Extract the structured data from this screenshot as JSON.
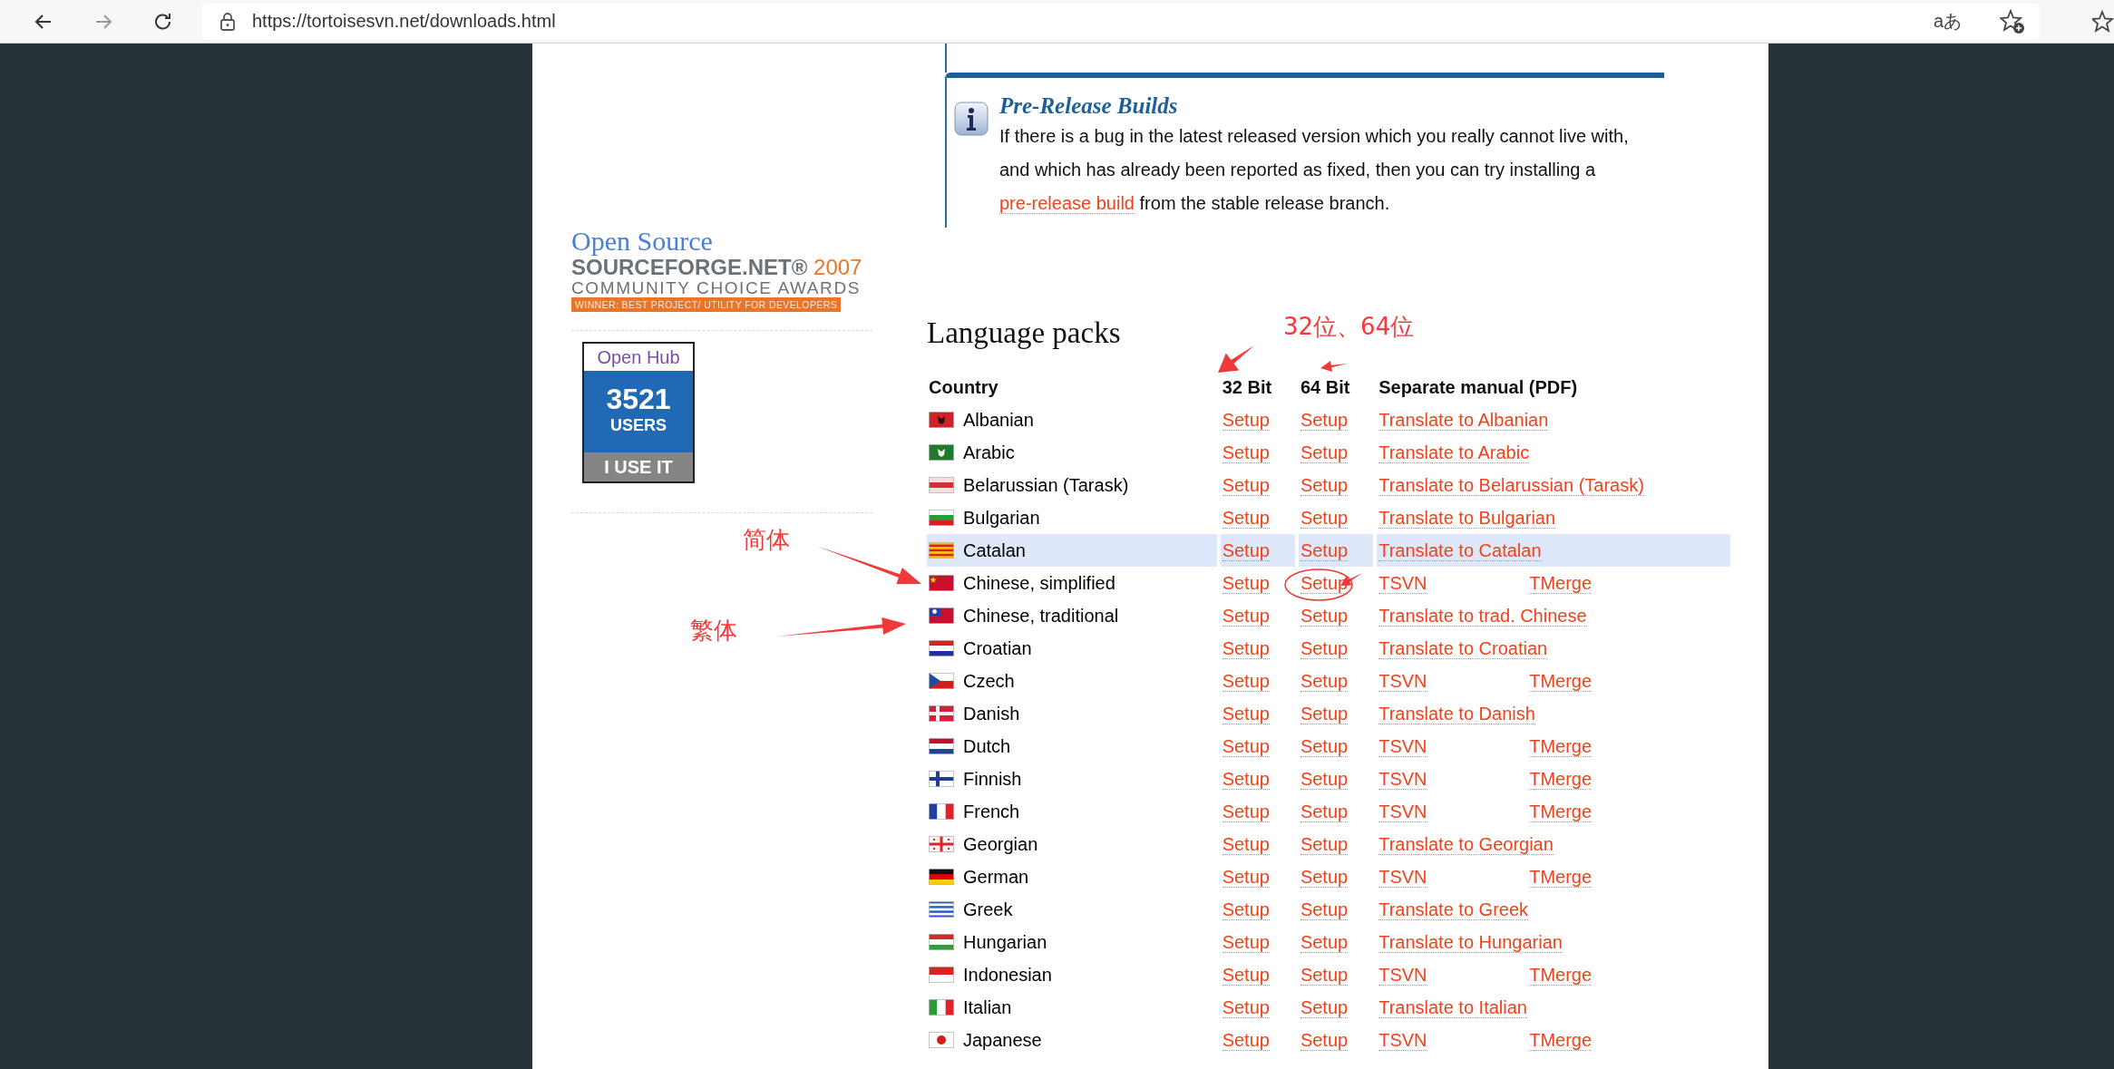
{
  "browser": {
    "nav": [
      {
        "kind": "back",
        "disabled": false
      },
      {
        "kind": "forward",
        "disabled": true
      },
      {
        "kind": "reload",
        "disabled": false
      }
    ],
    "url": "https://tortoisesvn.net/downloads.html",
    "reader_icon": "aあ"
  },
  "sidebar": {
    "award": {
      "title": "Open Source",
      "brand": "SOURCE**FORGE**.NET®",
      "year": "2007",
      "subtitle": "COMMUNITY CHOICE AWARDS",
      "banner": "WINNER: BEST PROJECT/ UTILITY FOR DEVELOPERS"
    },
    "badge": {
      "title": "Open Hub",
      "count": "3521",
      "unit": "USERS",
      "button": "I USE IT"
    }
  },
  "info_box": {
    "title": "Pre-Release Builds",
    "text": "If there is a bug in the latest released version which you really cannot live with, and which has already been reported as fixed, then you can try installing a ",
    "link": "pre-release build",
    "text_after": " from the stable release branch."
  },
  "language_packs": {
    "heading": "Language packs",
    "columns": [
      "Country",
      "32 Bit",
      "64 Bit",
      "Separate manual (PDF)"
    ],
    "rows": [
      {
        "country": "Albanian",
        "flag": {
          "kind": "emblem",
          "parts": [
            {
              "color": "#d0202a"
            },
            {
              "color": "#2a1010"
            }
          ]
        },
        "setup32": "Setup",
        "setup64": "Setup",
        "manual": [
          "Translate to Albanian"
        ],
        "highlighted": false
      },
      {
        "country": "Arabic",
        "flag": {
          "kind": "emblem",
          "parts": [
            {
              "color": "#1f7a2c"
            },
            {
              "color": "#e8f4e8"
            }
          ]
        },
        "setup32": "Setup",
        "setup64": "Setup",
        "manual": [
          "Translate to Arabic"
        ],
        "highlighted": false
      },
      {
        "country": "Belarussian (Tarask)",
        "flag": {
          "kind": "stripes",
          "parts": [
            {
              "color": "#f4dede"
            },
            {
              "color": "#d0303a"
            },
            {
              "color": "#f4dede"
            }
          ]
        },
        "setup32": "Setup",
        "setup64": "Setup",
        "manual": [
          "Translate to Belarussian (Tarask)"
        ],
        "highlighted": false
      },
      {
        "country": "Bulgarian",
        "flag": {
          "kind": "stripes",
          "parts": [
            {
              "color": "#ffffff"
            },
            {
              "color": "#2a9a3a"
            },
            {
              "color": "#d81e1e"
            }
          ]
        },
        "setup32": "Setup",
        "setup64": "Setup",
        "manual": [
          "Translate to Bulgarian"
        ],
        "highlighted": false
      },
      {
        "country": "Catalan",
        "flag": {
          "kind": "stripes",
          "parts": [
            {
              "color": "#f5c400"
            },
            {
              "color": "#d82020"
            },
            {
              "color": "#f5c400"
            },
            {
              "color": "#d82020"
            },
            {
              "color": "#f5c400"
            },
            {
              "color": "#d82020"
            },
            {
              "color": "#f5c400"
            }
          ]
        },
        "setup32": "Setup",
        "setup64": "Setup",
        "manual": [
          "Translate to Catalan"
        ],
        "highlighted": true
      },
      {
        "country": "Chinese, simplified",
        "flag": {
          "kind": "star",
          "parts": [
            {
              "color": "#c8102e"
            },
            {
              "color": "#ffde00"
            }
          ]
        },
        "setup32": "Setup",
        "setup64": "Setup",
        "manual": [
          "TSVN",
          "TMerge"
        ],
        "highlighted": false
      },
      {
        "country": "Chinese, traditional",
        "flag": {
          "kind": "canton",
          "parts": [
            {
              "color": "#c8102e"
            },
            {
              "color": "#1e3fb0"
            }
          ]
        },
        "setup32": "Setup",
        "setup64": "Setup",
        "manual": [
          "Translate to trad. Chinese"
        ],
        "highlighted": false
      },
      {
        "country": "Croatian",
        "flag": {
          "kind": "stripes",
          "parts": [
            {
              "color": "#e02020"
            },
            {
              "color": "#ffffff"
            },
            {
              "color": "#2030a0"
            }
          ]
        },
        "setup32": "Setup",
        "setup64": "Setup",
        "manual": [
          "Translate to Croatian"
        ],
        "highlighted": false
      },
      {
        "country": "Czech",
        "flag": {
          "kind": "triangle",
          "parts": [
            {
              "color": "#ffffff"
            },
            {
              "color": "#d41e1e"
            },
            {
              "color": "#1b4fa0"
            }
          ]
        },
        "setup32": "Setup",
        "setup64": "Setup",
        "manual": [
          "TSVN",
          "TMerge"
        ],
        "highlighted": false
      },
      {
        "country": "Danish",
        "flag": {
          "kind": "cross",
          "parts": [
            {
              "color": "#d81e3c"
            },
            {
              "color": "#f4f4f4"
            }
          ]
        },
        "setup32": "Setup",
        "setup64": "Setup",
        "manual": [
          "Translate to Danish"
        ],
        "highlighted": false
      },
      {
        "country": "Dutch",
        "flag": {
          "kind": "stripes",
          "parts": [
            {
              "color": "#c8102e"
            },
            {
              "color": "#ffffff"
            },
            {
              "color": "#21468b"
            }
          ]
        },
        "setup32": "Setup",
        "setup64": "Setup",
        "manual": [
          "TSVN",
          "TMerge"
        ],
        "highlighted": false
      },
      {
        "country": "Finnish",
        "flag": {
          "kind": "cross",
          "parts": [
            {
              "color": "#ffffff"
            },
            {
              "color": "#1c3f94"
            }
          ]
        },
        "setup32": "Setup",
        "setup64": "Setup",
        "manual": [
          "TSVN",
          "TMerge"
        ],
        "highlighted": false
      },
      {
        "country": "French",
        "flag": {
          "kind": "bars",
          "parts": [
            {
              "color": "#1f3fa0"
            },
            {
              "color": "#ffffff"
            },
            {
              "color": "#e0202a"
            }
          ]
        },
        "setup32": "Setup",
        "setup64": "Setup",
        "manual": [
          "TSVN",
          "TMerge"
        ],
        "highlighted": false
      },
      {
        "country": "Georgian",
        "flag": {
          "kind": "centercross",
          "parts": [
            {
              "color": "#f4f4f4"
            },
            {
              "color": "#e0202a"
            }
          ]
        },
        "setup32": "Setup",
        "setup64": "Setup",
        "manual": [
          "Translate to Georgian"
        ],
        "highlighted": false
      },
      {
        "country": "German",
        "flag": {
          "kind": "stripes",
          "parts": [
            {
              "color": "#111111"
            },
            {
              "color": "#dd0000"
            },
            {
              "color": "#ffce00"
            }
          ]
        },
        "setup32": "Setup",
        "setup64": "Setup",
        "manual": [
          "TSVN",
          "TMerge"
        ],
        "highlighted": false
      },
      {
        "country": "Greek",
        "flag": {
          "kind": "stripes",
          "parts": [
            {
              "color": "#2c5fcf"
            },
            {
              "color": "#ffffff"
            },
            {
              "color": "#2c5fcf"
            },
            {
              "color": "#ffffff"
            },
            {
              "color": "#2c5fcf"
            },
            {
              "color": "#ffffff"
            },
            {
              "color": "#2c5fcf"
            }
          ]
        },
        "setup32": "Setup",
        "setup64": "Setup",
        "manual": [
          "Translate to Greek"
        ],
        "highlighted": false
      },
      {
        "country": "Hungarian",
        "flag": {
          "kind": "stripes",
          "parts": [
            {
              "color": "#d62a2a"
            },
            {
              "color": "#ffffff"
            },
            {
              "color": "#3a9a3a"
            }
          ]
        },
        "setup32": "Setup",
        "setup64": "Setup",
        "manual": [
          "Translate to Hungarian"
        ],
        "highlighted": false
      },
      {
        "country": "Indonesian",
        "flag": {
          "kind": "stripes",
          "parts": [
            {
              "color": "#e02020"
            },
            {
              "color": "#ffffff"
            }
          ]
        },
        "setup32": "Setup",
        "setup64": "Setup",
        "manual": [
          "TSVN",
          "TMerge"
        ],
        "highlighted": false
      },
      {
        "country": "Italian",
        "flag": {
          "kind": "bars",
          "parts": [
            {
              "color": "#2a9a3a"
            },
            {
              "color": "#ffffff"
            },
            {
              "color": "#e0202a"
            }
          ]
        },
        "setup32": "Setup",
        "setup64": "Setup",
        "manual": [
          "Translate to Italian"
        ],
        "highlighted": false
      },
      {
        "country": "Japanese",
        "flag": {
          "kind": "disc",
          "parts": [
            {
              "color": "#ffffff"
            },
            {
              "color": "#d41e1e"
            }
          ]
        },
        "setup32": "Setup",
        "setup64": "Setup",
        "manual": [
          "TSVN",
          "TMerge"
        ],
        "highlighted": false
      }
    ]
  },
  "annotations": [
    {
      "kind": "label",
      "text": "32位、64位"
    },
    {
      "kind": "arrow"
    },
    {
      "kind": "arrow"
    },
    {
      "kind": "label",
      "text": "简体"
    },
    {
      "kind": "arrow"
    },
    {
      "kind": "label",
      "text": "繁体"
    },
    {
      "kind": "arrow"
    },
    {
      "kind": "ellipse"
    },
    {
      "kind": "arrow"
    }
  ]
}
